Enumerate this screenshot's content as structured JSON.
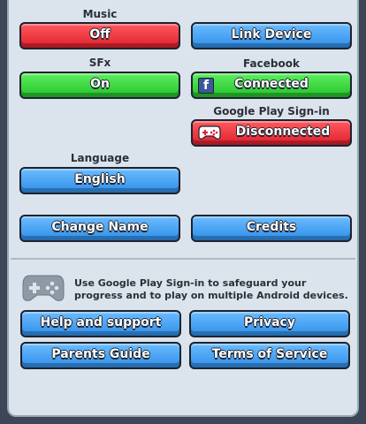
{
  "music": {
    "label": "Music",
    "button": "Off"
  },
  "link_device": {
    "button": "Link Device"
  },
  "sfx": {
    "label": "SFx",
    "button": "On"
  },
  "facebook": {
    "label": "Facebook",
    "button": "Connected",
    "icon": "facebook-icon"
  },
  "google_play": {
    "label": "Google Play Sign-in",
    "button": "Disconnected",
    "icon": "gamepad-icon"
  },
  "language": {
    "label": "Language",
    "button": "English"
  },
  "change_name": {
    "button": "Change Name"
  },
  "credits": {
    "button": "Credits"
  },
  "info": {
    "text": "Use Google Play Sign-in to safeguard your progress and to play on multiple Android devices.",
    "icon": "gamepad-icon"
  },
  "help": {
    "button": "Help and support"
  },
  "privacy": {
    "button": "Privacy"
  },
  "parents": {
    "button": "Parents Guide"
  },
  "terms": {
    "button": "Terms of Service"
  },
  "colors": {
    "red": "#e0202c",
    "blue": "#2f8ee8",
    "green": "#23c22b",
    "panel": "#dbe4ec",
    "frame": "#3c4657"
  }
}
